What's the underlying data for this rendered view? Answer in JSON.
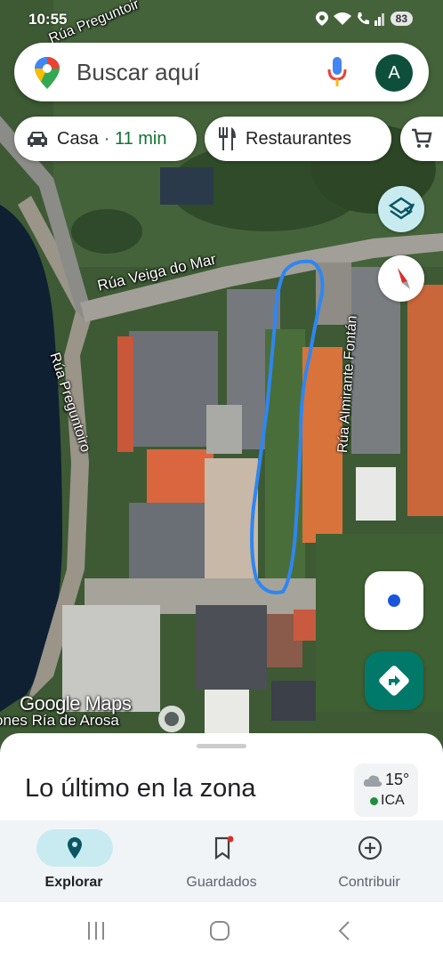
{
  "status_bar": {
    "time": "10:55",
    "battery": "83"
  },
  "search": {
    "placeholder": "Buscar aquí",
    "avatar_initial": "A"
  },
  "chips": {
    "home_label": "Casa",
    "home_separator": "·",
    "home_eta": "11 min",
    "restaurants_label": "Restaurantes"
  },
  "map": {
    "street_veiga": "Rúa Veiga do Mar",
    "street_almirante": "Rúa Almirante Fontán",
    "street_preguntoiro_side": "Rúa Preguntoiro",
    "street_preguntoiro_top": "Rúa Preguntoir",
    "area_label": "ones Ría de Arosa",
    "logo": "Google Maps"
  },
  "sheet": {
    "title": "Lo último en la zona",
    "temperature": "15°",
    "air_quality": "ICA"
  },
  "nav": {
    "explore": "Explorar",
    "saved": "Guardados",
    "contribute": "Contribuir"
  },
  "colors": {
    "accent": "#00796b",
    "chip_eta": "#137333",
    "explore_pill": "#c7ebf1",
    "drawn_outline": "#2f86f0",
    "avatar": "#0d4f3a"
  }
}
